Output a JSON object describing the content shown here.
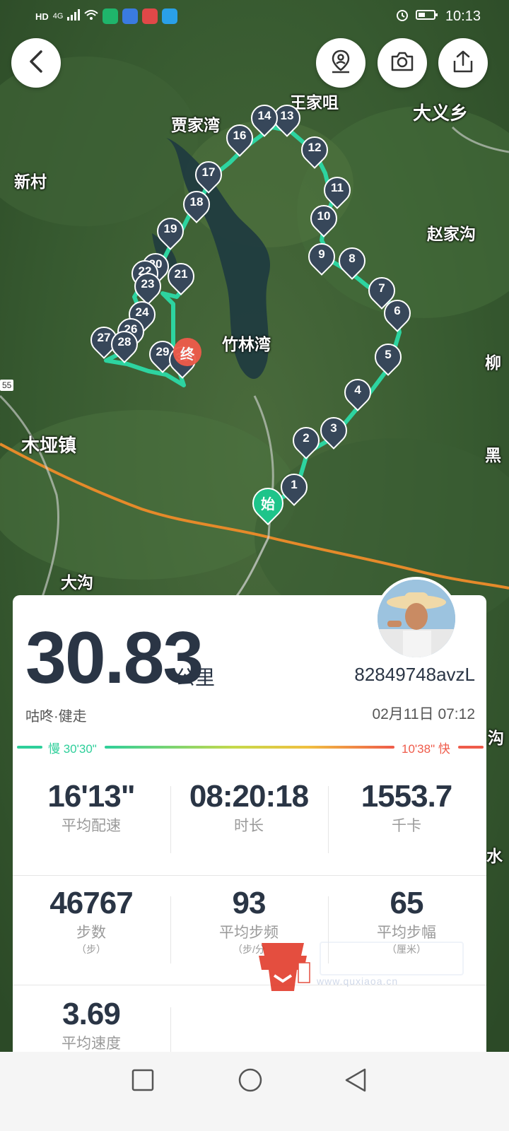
{
  "status_bar": {
    "left_icons": [
      "hd-icon",
      "4g-signal-icon",
      "wifi-icon",
      "app-icon-1",
      "app-icon-2",
      "app-icon-3",
      "app-icon-4"
    ],
    "hd": "HD",
    "net": "4G",
    "time": "10:13"
  },
  "map": {
    "places": [
      "王家咀",
      "大义乡",
      "贾家湾",
      "新村",
      "赵家沟",
      "竹林湾",
      "木垭镇",
      "大沟",
      "柳",
      "黑",
      "沟",
      "水"
    ],
    "route_markers": [
      "1",
      "2",
      "3",
      "4",
      "5",
      "6",
      "7",
      "8",
      "9",
      "10",
      "11",
      "12",
      "13",
      "14",
      "16",
      "17",
      "18",
      "19",
      "20",
      "21",
      "22",
      "23",
      "24",
      "26",
      "27",
      "28",
      "29",
      "30"
    ],
    "start_label": "始",
    "end_label": "终",
    "road_number": "55",
    "colors": {
      "route": "#2dd4a0",
      "marker": "#37475a",
      "start": "#1ec48a",
      "end": "#ef5b4a",
      "road": "#e58a2a"
    }
  },
  "buttons": {
    "back": "back-chevron-icon",
    "location": "location-person-icon",
    "camera": "camera-icon",
    "share": "share-icon"
  },
  "summary": {
    "distance": "30.83",
    "unit": "公里",
    "username": "82849748avzL",
    "sport": "咕咚·健走",
    "date": "02月11日 07:12",
    "pace_slow": "慢 30'30\"",
    "pace_fast": "10'38\" 快"
  },
  "stats": [
    {
      "value": "16'13\"",
      "label": "平均配速",
      "sub": ""
    },
    {
      "value": "08:20:18",
      "label": "时长",
      "sub": ""
    },
    {
      "value": "1553.7",
      "label": "千卡",
      "sub": ""
    },
    {
      "value": "46767",
      "label": "步数",
      "sub": "（步）"
    },
    {
      "value": "93",
      "label": "平均步频",
      "sub": "（步/分"
    },
    {
      "value": "65",
      "label": "平均步幅",
      "sub": "（厘米）"
    },
    {
      "value": "3.69",
      "label": "平均速度",
      "sub": ""
    }
  ],
  "watermark": "www.quxiaoa.cn",
  "nav": [
    "square-recent-icon",
    "circle-home-icon",
    "triangle-back-icon"
  ]
}
